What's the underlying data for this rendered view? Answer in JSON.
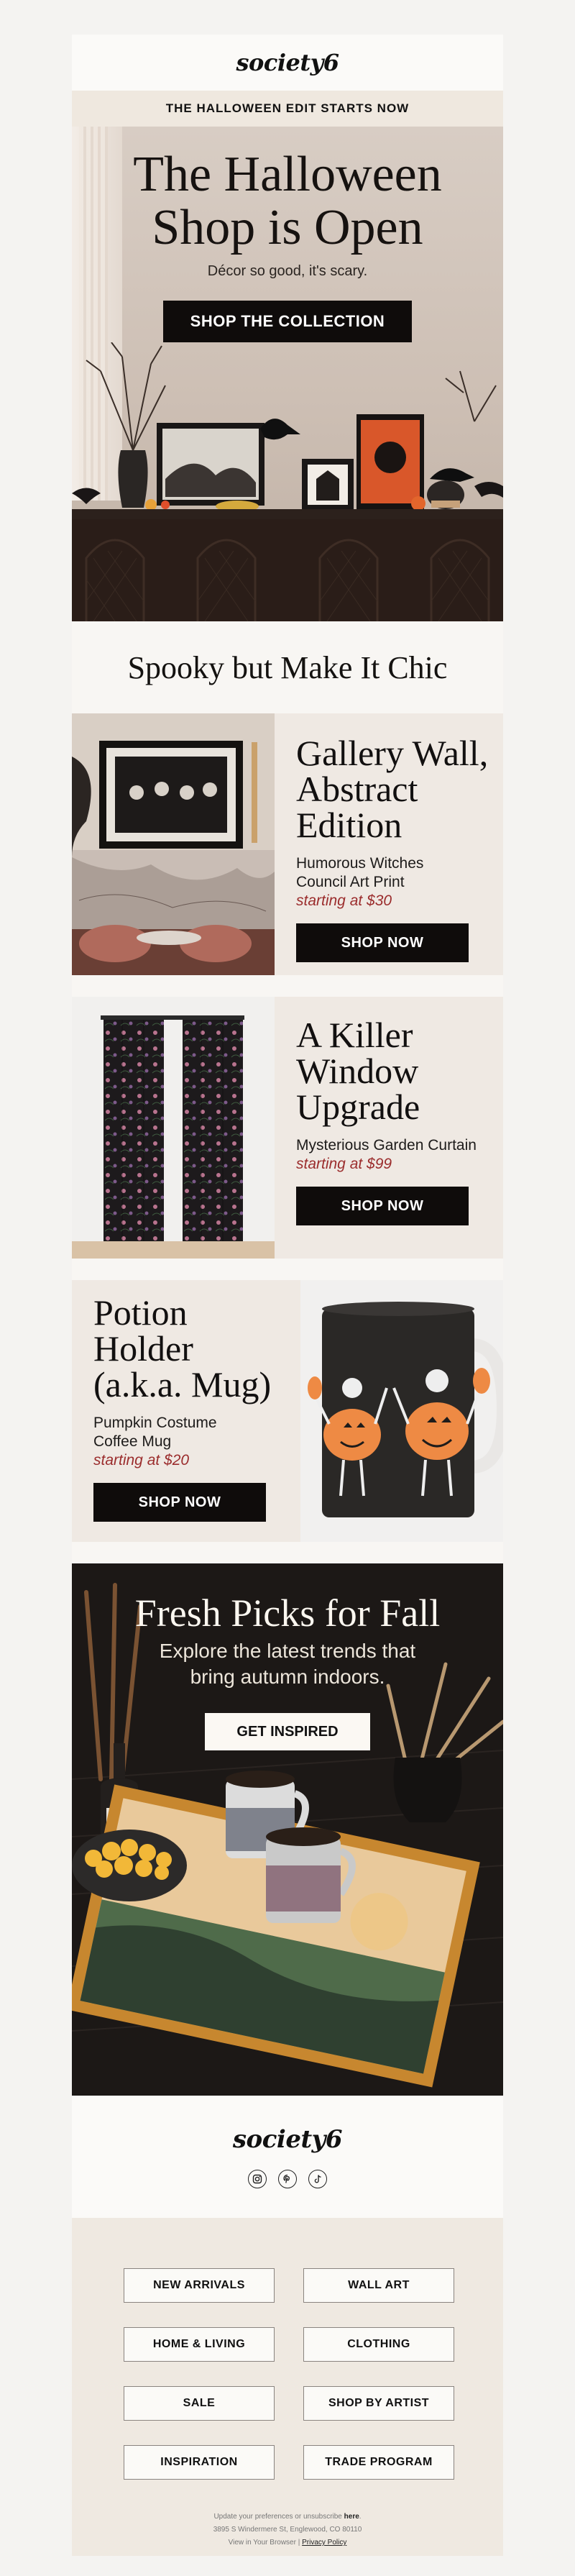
{
  "header": {
    "logo": "society6",
    "announcement": "THE HALLOWEEN EDIT STARTS NOW"
  },
  "hero": {
    "title_line1": "The Halloween",
    "title_line2": "Shop is Open",
    "subtitle": "Décor so good, it's scary.",
    "cta": "SHOP THE COLLECTION"
  },
  "section_heading": "Spooky but Make It Chic",
  "products": [
    {
      "title_lines": [
        "Gallery Wall,",
        "Abstract",
        "Edition"
      ],
      "name_lines": [
        "Humorous Witches",
        "Council Art Print"
      ],
      "price": "starting at $30",
      "cta": "SHOP NOW"
    },
    {
      "title_lines": [
        "A Killer",
        "Window",
        "Upgrade"
      ],
      "name_lines": [
        "Mysterious Garden Curtain"
      ],
      "price": "starting at $99",
      "cta": "SHOP NOW"
    },
    {
      "title_lines": [
        "Potion",
        "Holder",
        "(a.k.a. Mug)"
      ],
      "name_lines": [
        "Pumpkin Costume",
        "Coffee Mug"
      ],
      "price": "starting at $20",
      "cta": "SHOP NOW"
    }
  ],
  "fresh": {
    "title": "Fresh Picks for Fall",
    "subtitle_line1": "Explore the latest trends that",
    "subtitle_line2": "bring autumn indoors.",
    "cta": "GET INSPIRED"
  },
  "footer": {
    "logo": "society6",
    "socials": [
      "instagram-icon",
      "pinterest-icon",
      "tiktok-icon"
    ],
    "links": [
      "NEW ARRIVALS",
      "WALL ART",
      "HOME & LIVING",
      "CLOTHING",
      "SALE",
      "SHOP BY ARTIST",
      "INSPIRATION",
      "TRADE PROGRAM"
    ],
    "prefs_text": "Update your preferences or unsubscribe",
    "prefs_link": "here",
    "address": "3895 S Windermere St, Englewood, CO 80110",
    "view_browser": "View in Your Browser",
    "privacy": "Privacy Policy"
  },
  "colors": {
    "button": "#0f0c0b",
    "price": "#9b2d2d",
    "panel": "#efe9e3",
    "announce": "#efe8df"
  }
}
